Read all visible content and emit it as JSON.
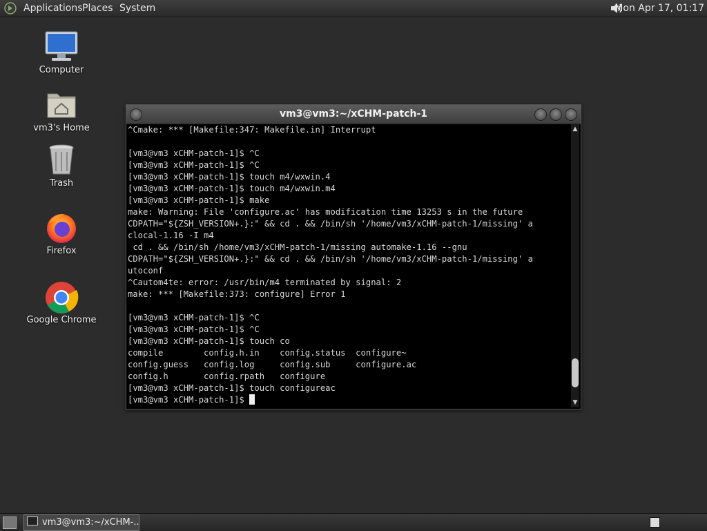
{
  "top_panel": {
    "menus": [
      "Applications",
      "Places",
      "System"
    ],
    "clock": "Mon Apr 17, 01:17"
  },
  "desktop_icons": [
    {
      "label": "Computer",
      "icon": "computer-icon"
    },
    {
      "label": "vm3's Home",
      "icon": "home-folder-icon"
    },
    {
      "label": "Trash",
      "icon": "trash-icon"
    },
    {
      "label": "Firefox",
      "icon": "firefox-icon"
    },
    {
      "label": "Google Chrome",
      "icon": "chrome-icon"
    }
  ],
  "terminal": {
    "title": "vm3@vm3:~/xCHM-patch-1",
    "lines": [
      "^Cmake: *** [Makefile:347: Makefile.in] Interrupt",
      "",
      "[vm3@vm3 xCHM-patch-1]$ ^C",
      "[vm3@vm3 xCHM-patch-1]$ ^C",
      "[vm3@vm3 xCHM-patch-1]$ touch m4/wxwin.4",
      "[vm3@vm3 xCHM-patch-1]$ touch m4/wxwin.m4",
      "[vm3@vm3 xCHM-patch-1]$ make",
      "make: Warning: File 'configure.ac' has modification time 13253 s in the future",
      "CDPATH=\"${ZSH_VERSION+.}:\" && cd . && /bin/sh '/home/vm3/xCHM-patch-1/missing' a",
      "clocal-1.16 -I m4",
      " cd . && /bin/sh /home/vm3/xCHM-patch-1/missing automake-1.16 --gnu",
      "CDPATH=\"${ZSH_VERSION+.}:\" && cd . && /bin/sh '/home/vm3/xCHM-patch-1/missing' a",
      "utoconf",
      "^Cautom4te: error: /usr/bin/m4 terminated by signal: 2",
      "make: *** [Makefile:373: configure] Error 1",
      "",
      "[vm3@vm3 xCHM-patch-1]$ ^C",
      "[vm3@vm3 xCHM-patch-1]$ ^C",
      "[vm3@vm3 xCHM-patch-1]$ touch co",
      "compile        config.h.in    config.status  configure~",
      "config.guess   config.log     config.sub     configure.ac",
      "config.h       config.rpath   configure",
      "[vm3@vm3 xCHM-patch-1]$ touch configureac"
    ],
    "prompt": "[vm3@vm3 xCHM-patch-1]$ ",
    "scroll_position": 0.95
  },
  "bottom_panel": {
    "task_label": "vm3@vm3:~/xCHM-..."
  },
  "colors": {
    "desktop_bg": "#2c2c2c",
    "terminal_bg": "#000000",
    "terminal_fg": "#d8d8d8"
  }
}
